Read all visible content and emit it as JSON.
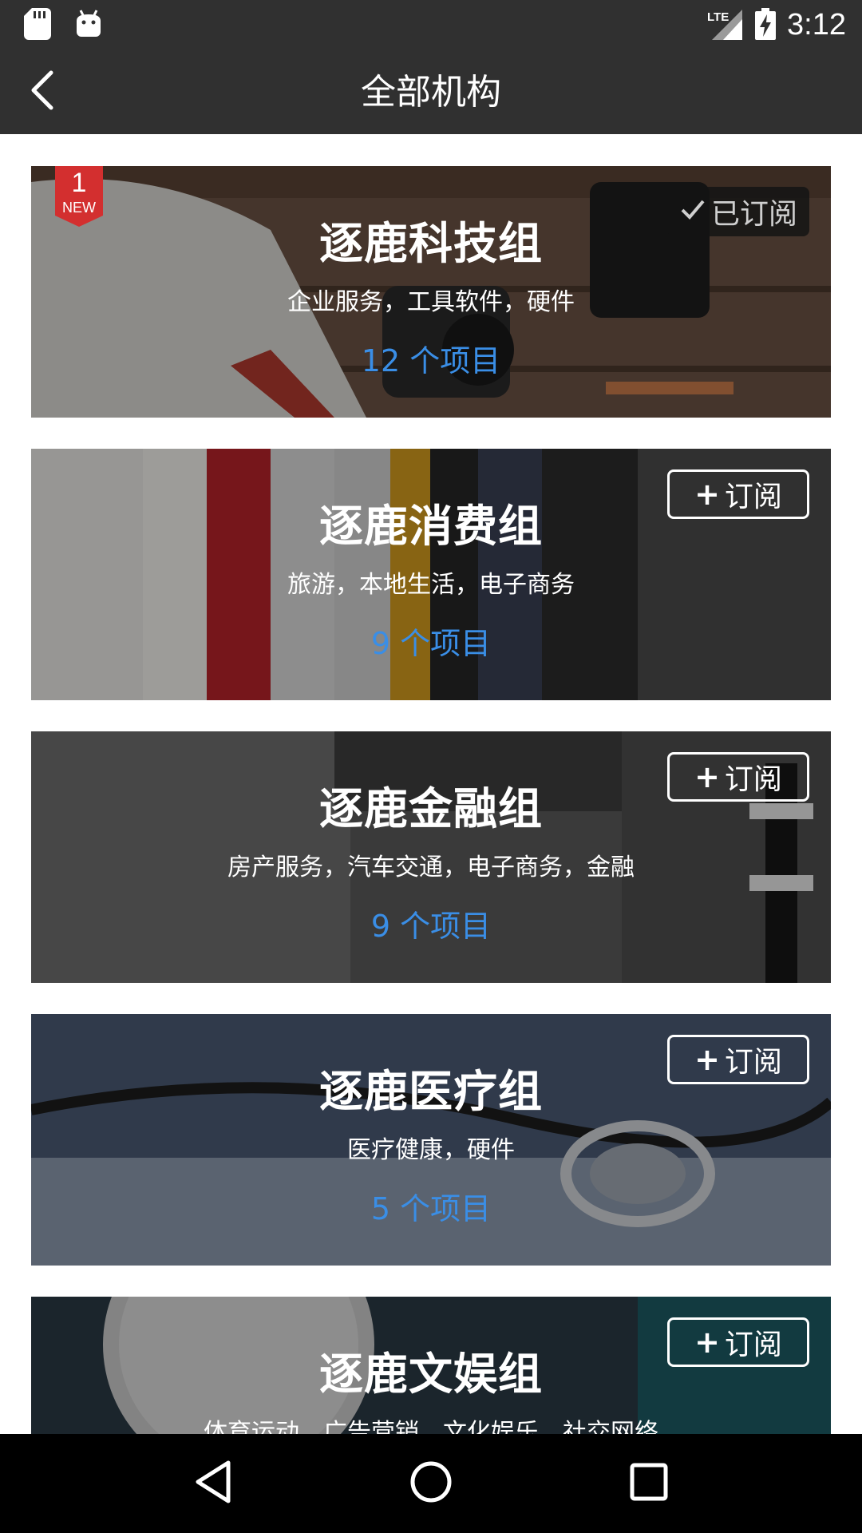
{
  "status_bar": {
    "time": "3:12",
    "network": "LTE",
    "icons": [
      "sd-card-icon",
      "android-icon",
      "lte-signal-icon",
      "battery-charging-icon"
    ]
  },
  "app_bar": {
    "title": "全部机构",
    "back_icon": "back-arrow-icon"
  },
  "cards": [
    {
      "name": "逐鹿科技组",
      "tags": "企业服务，工具软件，硬件",
      "count": "12 个项目",
      "subscribed": true,
      "subscribe_label": "已订阅",
      "badge": {
        "number": "1",
        "text": "NEW"
      }
    },
    {
      "name": "逐鹿消费组",
      "tags": "旅游，本地生活，电子商务",
      "count": "9 个项目",
      "subscribed": false,
      "subscribe_label": "订阅"
    },
    {
      "name": "逐鹿金融组",
      "tags": "房产服务，汽车交通，电子商务，金融",
      "count": "9 个项目",
      "subscribed": false,
      "subscribe_label": "订阅"
    },
    {
      "name": "逐鹿医疗组",
      "tags": "医疗健康，硬件",
      "count": "5 个项目",
      "subscribed": false,
      "subscribe_label": "订阅"
    },
    {
      "name": "逐鹿文娱组",
      "tags": "体育运动，广告营销，文化娱乐，社交网络",
      "count": "",
      "subscribed": false,
      "subscribe_label": "订阅"
    }
  ],
  "plus_sign": "+",
  "colors": {
    "bar": "#303030",
    "count_blue": "#3a8ee6",
    "badge_red": "#d32f2f"
  }
}
